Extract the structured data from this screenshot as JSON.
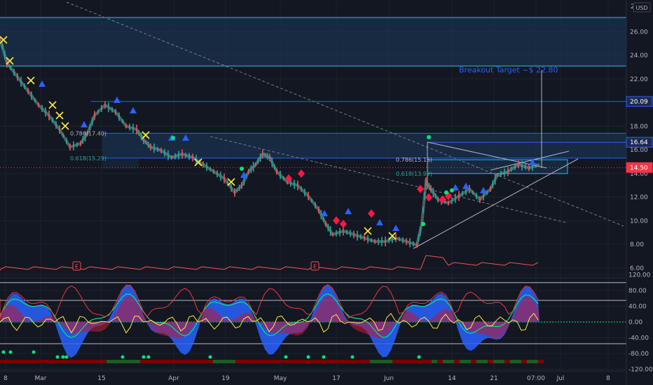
{
  "currency": "USD",
  "price_axis": {
    "labels": [
      "26.00",
      "24.00",
      "22.00",
      "18.00",
      "16.00",
      "14.00",
      "12.00",
      "10.00",
      "8.00",
      "6.00"
    ],
    "values": [
      26,
      24,
      22,
      18,
      16,
      14,
      12,
      10,
      8,
      6
    ],
    "top_partial": "2"
  },
  "price_badges": [
    {
      "label": "20.09",
      "value": 20.09,
      "color": "#1e2a4a",
      "border": "#2962ff"
    },
    {
      "label": "16.64",
      "value": 16.64,
      "color": "#1e2a4a",
      "border": "#2962ff"
    },
    {
      "label": "14.50",
      "value": 14.5,
      "color": "#f23645",
      "border": "#f23645"
    }
  ],
  "osc_axis": {
    "labels": [
      "120.00",
      "80.00",
      "40.00",
      "0.00",
      "-40.00",
      "-80.00",
      "-120.00"
    ],
    "values": [
      120,
      80,
      40,
      0,
      -40,
      -80,
      -120
    ]
  },
  "time_axis": {
    "labels": [
      "8",
      "Mar",
      "15",
      "Apr",
      "19",
      "May",
      "17",
      "Jun",
      "14",
      "21",
      "07:00",
      "Jul",
      "8"
    ]
  },
  "fib_labels": [
    {
      "text": "0.786(17.40)",
      "price": 17.4,
      "where": "left",
      "color": "#b2b5be"
    },
    {
      "text": "0.618(15.29)",
      "price": 15.29,
      "where": "left",
      "color": "#26a69a"
    },
    {
      "text": "0.786(15.16)",
      "price": 15.16,
      "where": "right",
      "color": "#b2b5be"
    },
    {
      "text": "0.618(13.99)",
      "price": 13.99,
      "where": "right",
      "color": "#26a69a"
    }
  ],
  "annotation": {
    "text": "Breakout Target ~$ 22.80",
    "price": 22.8
  },
  "earnings_marker": "E",
  "chart_data": {
    "type": "line",
    "price_ylim": [
      5,
      28
    ],
    "osc_ylim": [
      -130,
      125
    ],
    "zones": [
      {
        "from": 23.1,
        "to": 27.2
      },
      {
        "from": 15.3,
        "to": 17.4
      }
    ],
    "levels": [
      20.09,
      16.64,
      15.16,
      13.99
    ],
    "current_price": 14.5,
    "target": 22.8
  },
  "colors": {
    "bg": "#131722",
    "grid": "#1e222d",
    "zone": "#1b3a5c",
    "zone_line": "#26c6da",
    "level": "#2962ff",
    "candle_up": "#26a69a",
    "candle_down": "#ef5350",
    "osc_blue": "#2962ff",
    "osc_red": "#b71c3c",
    "osc_green": "#00e676",
    "osc_yellow": "#ffeb3b"
  }
}
